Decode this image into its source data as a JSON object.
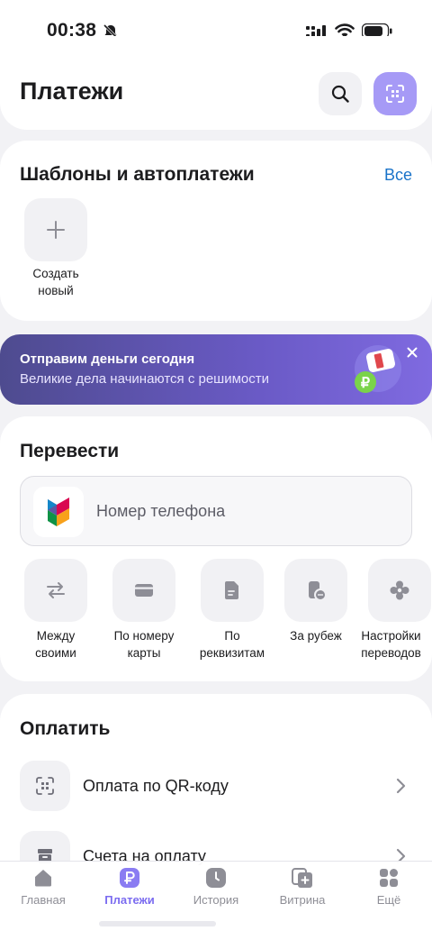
{
  "status": {
    "time": "00:38"
  },
  "header": {
    "title": "Платежи"
  },
  "templates": {
    "title": "Шаблоны и автоплатежи",
    "all_label": "Все",
    "create_label_line1": "Создать",
    "create_label_line2": "новый"
  },
  "banner": {
    "title": "Отправим деньги сегодня",
    "subtitle": "Великие дела начинаются с решимости"
  },
  "transfer": {
    "title": "Перевести",
    "phone_placeholder": "Номер телефона",
    "actions": [
      {
        "line1": "Между",
        "line2": "своими",
        "icon": "swap-arrows-icon"
      },
      {
        "line1": "По номеру",
        "line2": "карты",
        "icon": "card-icon"
      },
      {
        "line1": "По",
        "line2": "реквизитам",
        "icon": "document-icon"
      },
      {
        "line1": "За рубеж",
        "line2": "",
        "icon": "abroad-icon"
      },
      {
        "line1": "Настройки",
        "line2": "переводов",
        "icon": "gear-icon"
      }
    ]
  },
  "pay": {
    "title": "Оплатить",
    "rows": [
      {
        "label": "Оплата по QR-коду",
        "icon": "qr-scan-icon"
      },
      {
        "label": "Счета на оплату",
        "icon": "inbox-icon"
      }
    ]
  },
  "tabbar": {
    "items": [
      {
        "label": "Главная",
        "icon": "home-icon"
      },
      {
        "label": "Платежи",
        "icon": "ruble-icon",
        "active": true
      },
      {
        "label": "История",
        "icon": "clock-icon"
      },
      {
        "label": "Витрина",
        "icon": "showcase-icon"
      },
      {
        "label": "Ещё",
        "icon": "grid-icon"
      }
    ]
  },
  "colors": {
    "accent": "#7b6cf0",
    "link": "#1a73c9",
    "banner_start": "#4e4b8f",
    "banner_end": "#7f6ae0"
  }
}
